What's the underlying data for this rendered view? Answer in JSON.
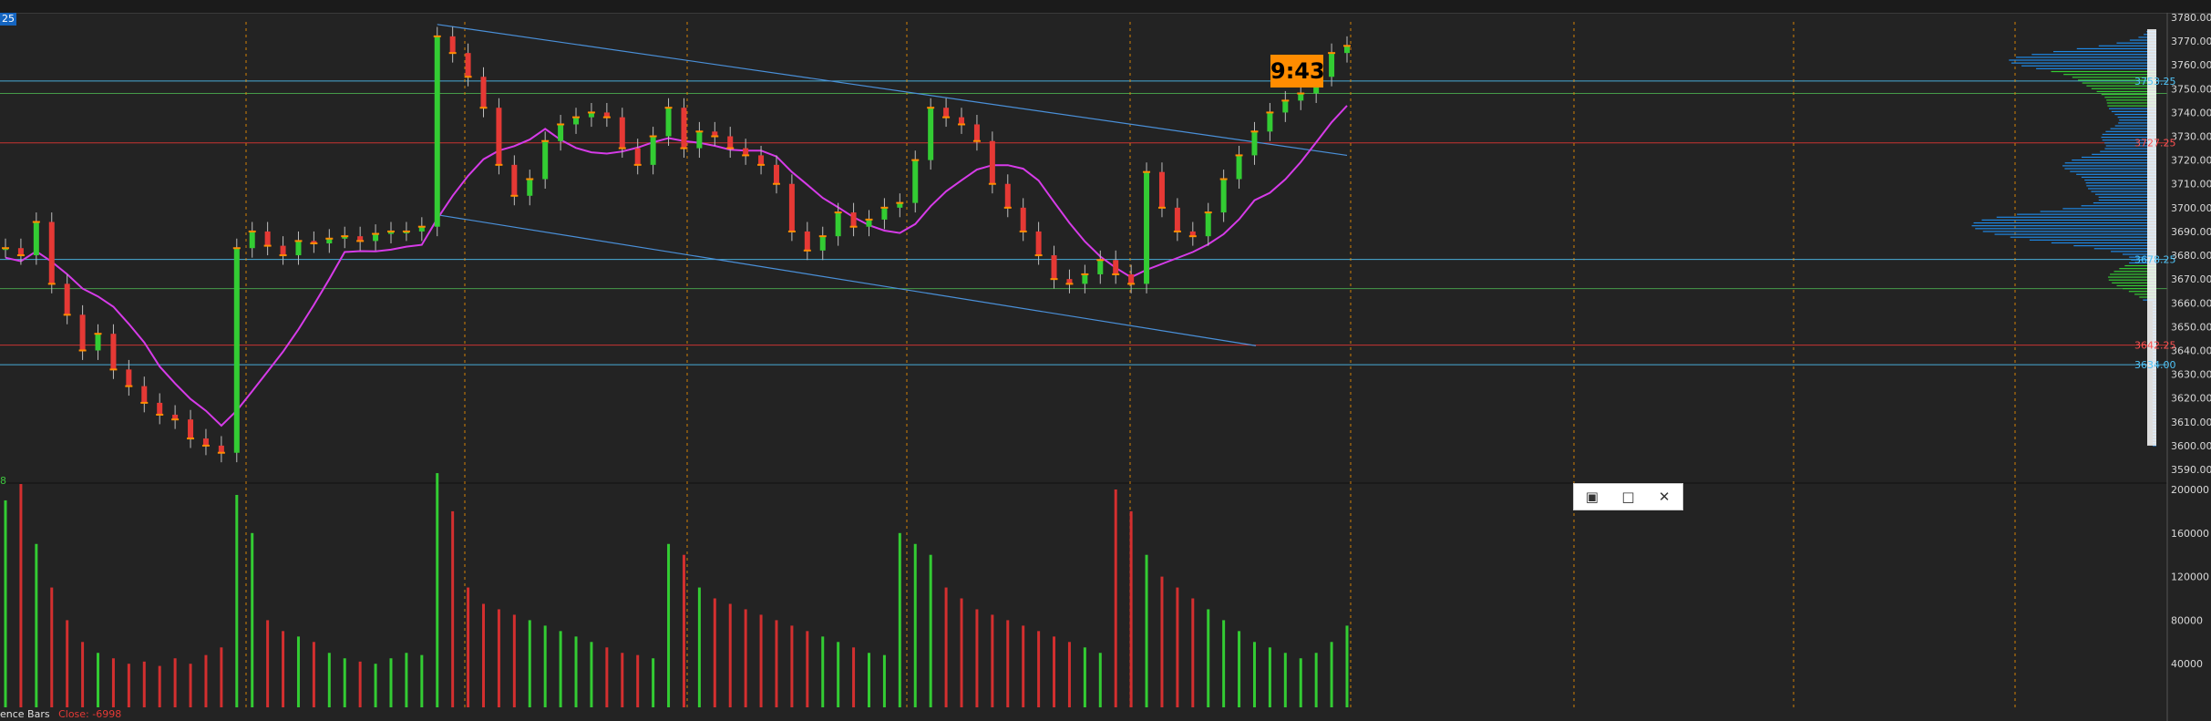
{
  "window": {
    "tab_label": "25"
  },
  "price_axis": {
    "ticks": [
      "3780.00",
      "3770.00",
      "3760.00",
      "3750.00",
      "3740.00",
      "3730.00",
      "3720.00",
      "3710.00",
      "3700.00",
      "3690.00",
      "3680.00",
      "3670.00",
      "3660.00",
      "3650.00",
      "3640.00",
      "3630.00",
      "3620.00",
      "3610.00",
      "3600.00",
      "3590.00"
    ]
  },
  "volume_axis": {
    "ticks": [
      "200000",
      "160000",
      "120000",
      "80000",
      "40000"
    ]
  },
  "level_labels": [
    {
      "text": "3753.25",
      "color": "#4fc3f7"
    },
    {
      "text": "3727.25",
      "color": "#ff5252"
    },
    {
      "text": "3678.25",
      "color": "#4fc3f7"
    },
    {
      "text": "3642.25",
      "color": "#ff5252"
    },
    {
      "text": "3634.00",
      "color": "#4fc3f7"
    }
  ],
  "clock_badge": "9:43",
  "float_panel": {
    "restore_icon": "▣",
    "maximize_icon": "□",
    "close_icon": "✕"
  },
  "volume_pane_label": "8",
  "footer": {
    "indicator_name": "ence Bars",
    "close_value": "Close: -6998"
  },
  "chart_data": {
    "type": "candlestick",
    "price_range": [
      3590,
      3780
    ],
    "volume_range": [
      0,
      200000
    ],
    "horizontal_levels": [
      {
        "price": 3753.25,
        "color": "#4fc3f7"
      },
      {
        "price": 3748,
        "color": "#4caf50"
      },
      {
        "price": 3727.25,
        "color": "#e53935"
      },
      {
        "price": 3678.25,
        "color": "#4fc3f7"
      },
      {
        "price": 3666,
        "color": "#4caf50"
      },
      {
        "price": 3642.25,
        "color": "#e53935"
      },
      {
        "price": 3634.0,
        "color": "#4fc3f7"
      }
    ],
    "trend_lines": [
      {
        "from": [
          0,
          3777
        ],
        "to": [
          1,
          3722
        ]
      },
      {
        "from": [
          0,
          3697
        ],
        "to": [
          1,
          3642
        ]
      }
    ],
    "candles": [
      3683,
      3680,
      3694,
      3668,
      3655,
      3640,
      3647,
      3632,
      3625,
      3618,
      3613,
      3611,
      3603,
      3600,
      3597,
      3683,
      3690,
      3684,
      3680,
      3686,
      3685,
      3687,
      3688,
      3686,
      3689,
      3690,
      3690,
      3692,
      3772,
      3765,
      3755,
      3742,
      3718,
      3705,
      3712,
      3728,
      3735,
      3738,
      3740,
      3738,
      3725,
      3718,
      3730,
      3742,
      3725,
      3732,
      3730,
      3725,
      3722,
      3718,
      3710,
      3690,
      3682,
      3688,
      3698,
      3692,
      3695,
      3700,
      3702,
      3720,
      3742,
      3738,
      3735,
      3728,
      3710,
      3700,
      3690,
      3680,
      3670,
      3668,
      3672,
      3678,
      3672,
      3668,
      3715,
      3700,
      3690,
      3688,
      3698,
      3712,
      3722,
      3732,
      3740,
      3745,
      3748,
      3755,
      3765,
      3768
    ],
    "volume_series": [
      {
        "name": "",
        "values": [
          190000,
          205000,
          150000,
          110000,
          80000,
          60000,
          50000,
          45000,
          40000,
          42000,
          38000,
          45000,
          40000,
          48000,
          55000,
          195000,
          160000,
          80000,
          70000,
          65000,
          60000,
          50000,
          45000,
          42000,
          40000,
          45000,
          50000,
          48000,
          215000,
          180000,
          110000,
          95000,
          90000,
          85000,
          80000,
          75000,
          70000,
          65000,
          60000,
          55000,
          50000,
          48000,
          45000,
          150000,
          140000,
          110000,
          100000,
          95000,
          90000,
          85000,
          80000,
          75000,
          70000,
          65000,
          60000,
          55000,
          50000,
          48000,
          160000,
          150000,
          140000,
          110000,
          100000,
          90000,
          85000,
          80000,
          75000,
          70000,
          65000,
          60000,
          55000,
          50000,
          200000,
          180000,
          140000,
          120000,
          110000,
          100000,
          90000,
          80000,
          70000,
          60000,
          55000,
          50000,
          45000,
          50000,
          60000,
          75000
        ]
      }
    ]
  }
}
